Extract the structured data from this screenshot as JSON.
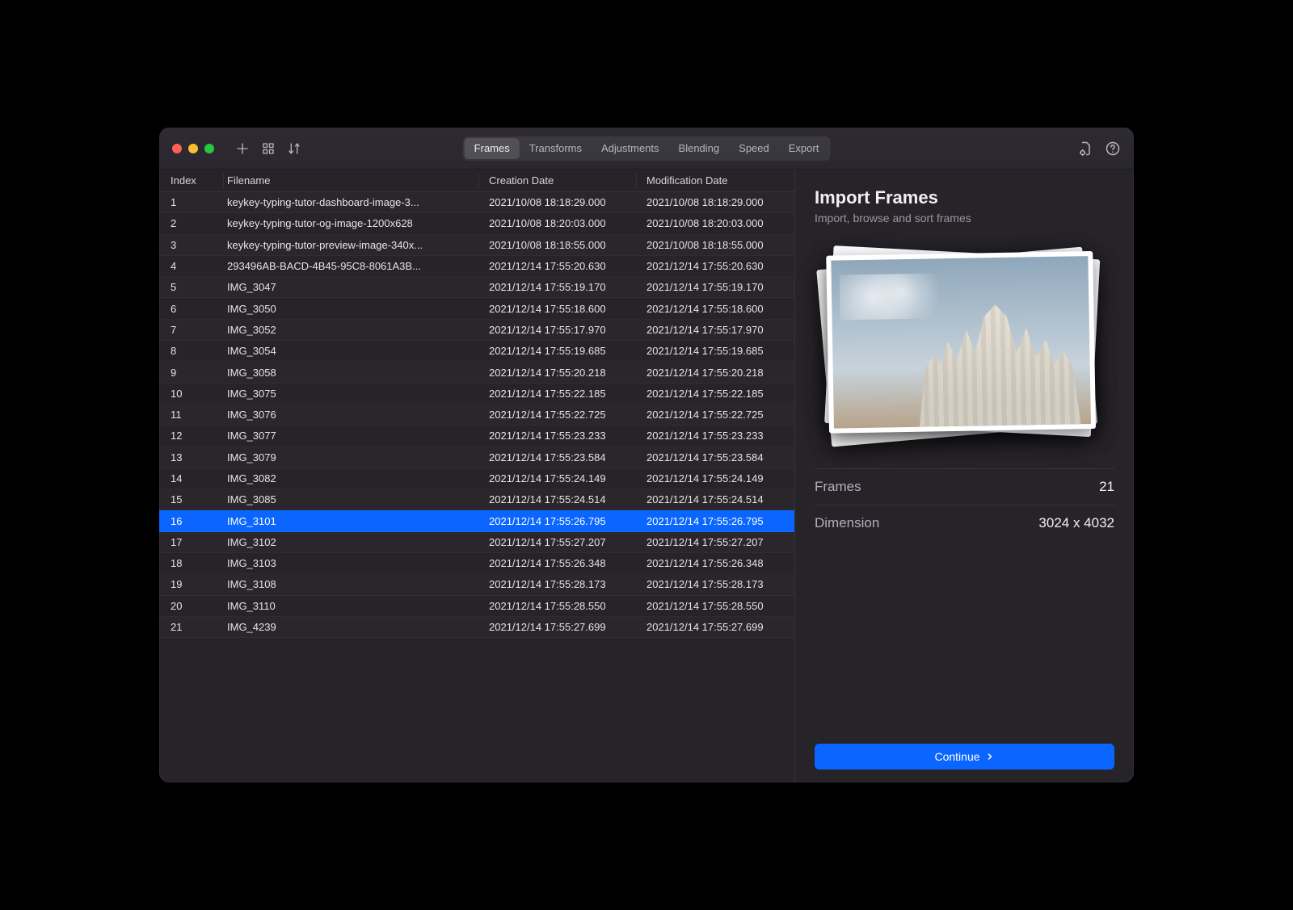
{
  "toolbar": {
    "tabs": [
      "Frames",
      "Transforms",
      "Adjustments",
      "Blending",
      "Speed",
      "Export"
    ],
    "activeTab": 0
  },
  "columns": {
    "index": "Index",
    "filename": "Filename",
    "creation": "Creation Date",
    "modification": "Modification Date"
  },
  "selectedRow": 15,
  "rows": [
    {
      "index": "1",
      "filename": "keykey-typing-tutor-dashboard-image-3...",
      "created": "2021/10/08 18:18:29.000",
      "modified": "2021/10/08 18:18:29.000"
    },
    {
      "index": "2",
      "filename": "keykey-typing-tutor-og-image-1200x628",
      "created": "2021/10/08 18:20:03.000",
      "modified": "2021/10/08 18:20:03.000"
    },
    {
      "index": "3",
      "filename": "keykey-typing-tutor-preview-image-340x...",
      "created": "2021/10/08 18:18:55.000",
      "modified": "2021/10/08 18:18:55.000"
    },
    {
      "index": "4",
      "filename": "293496AB-BACD-4B45-95C8-8061A3B...",
      "created": "2021/12/14 17:55:20.630",
      "modified": "2021/12/14 17:55:20.630"
    },
    {
      "index": "5",
      "filename": "IMG_3047",
      "created": "2021/12/14 17:55:19.170",
      "modified": "2021/12/14 17:55:19.170"
    },
    {
      "index": "6",
      "filename": "IMG_3050",
      "created": "2021/12/14 17:55:18.600",
      "modified": "2021/12/14 17:55:18.600"
    },
    {
      "index": "7",
      "filename": "IMG_3052",
      "created": "2021/12/14 17:55:17.970",
      "modified": "2021/12/14 17:55:17.970"
    },
    {
      "index": "8",
      "filename": "IMG_3054",
      "created": "2021/12/14 17:55:19.685",
      "modified": "2021/12/14 17:55:19.685"
    },
    {
      "index": "9",
      "filename": "IMG_3058",
      "created": "2021/12/14 17:55:20.218",
      "modified": "2021/12/14 17:55:20.218"
    },
    {
      "index": "10",
      "filename": "IMG_3075",
      "created": "2021/12/14 17:55:22.185",
      "modified": "2021/12/14 17:55:22.185"
    },
    {
      "index": "11",
      "filename": "IMG_3076",
      "created": "2021/12/14 17:55:22.725",
      "modified": "2021/12/14 17:55:22.725"
    },
    {
      "index": "12",
      "filename": "IMG_3077",
      "created": "2021/12/14 17:55:23.233",
      "modified": "2021/12/14 17:55:23.233"
    },
    {
      "index": "13",
      "filename": "IMG_3079",
      "created": "2021/12/14 17:55:23.584",
      "modified": "2021/12/14 17:55:23.584"
    },
    {
      "index": "14",
      "filename": "IMG_3082",
      "created": "2021/12/14 17:55:24.149",
      "modified": "2021/12/14 17:55:24.149"
    },
    {
      "index": "15",
      "filename": "IMG_3085",
      "created": "2021/12/14 17:55:24.514",
      "modified": "2021/12/14 17:55:24.514"
    },
    {
      "index": "16",
      "filename": "IMG_3101",
      "created": "2021/12/14 17:55:26.795",
      "modified": "2021/12/14 17:55:26.795"
    },
    {
      "index": "17",
      "filename": "IMG_3102",
      "created": "2021/12/14 17:55:27.207",
      "modified": "2021/12/14 17:55:27.207"
    },
    {
      "index": "18",
      "filename": "IMG_3103",
      "created": "2021/12/14 17:55:26.348",
      "modified": "2021/12/14 17:55:26.348"
    },
    {
      "index": "19",
      "filename": "IMG_3108",
      "created": "2021/12/14 17:55:28.173",
      "modified": "2021/12/14 17:55:28.173"
    },
    {
      "index": "20",
      "filename": "IMG_3110",
      "created": "2021/12/14 17:55:28.550",
      "modified": "2021/12/14 17:55:28.550"
    },
    {
      "index": "21",
      "filename": "IMG_4239",
      "created": "2021/12/14 17:55:27.699",
      "modified": "2021/12/14 17:55:27.699"
    }
  ],
  "inspector": {
    "title": "Import Frames",
    "subtitle": "Import, browse and sort frames",
    "frames_label": "Frames",
    "frames_value": "21",
    "dimension_label": "Dimension",
    "dimension_value": "3024 x 4032",
    "continue_label": "Continue"
  }
}
